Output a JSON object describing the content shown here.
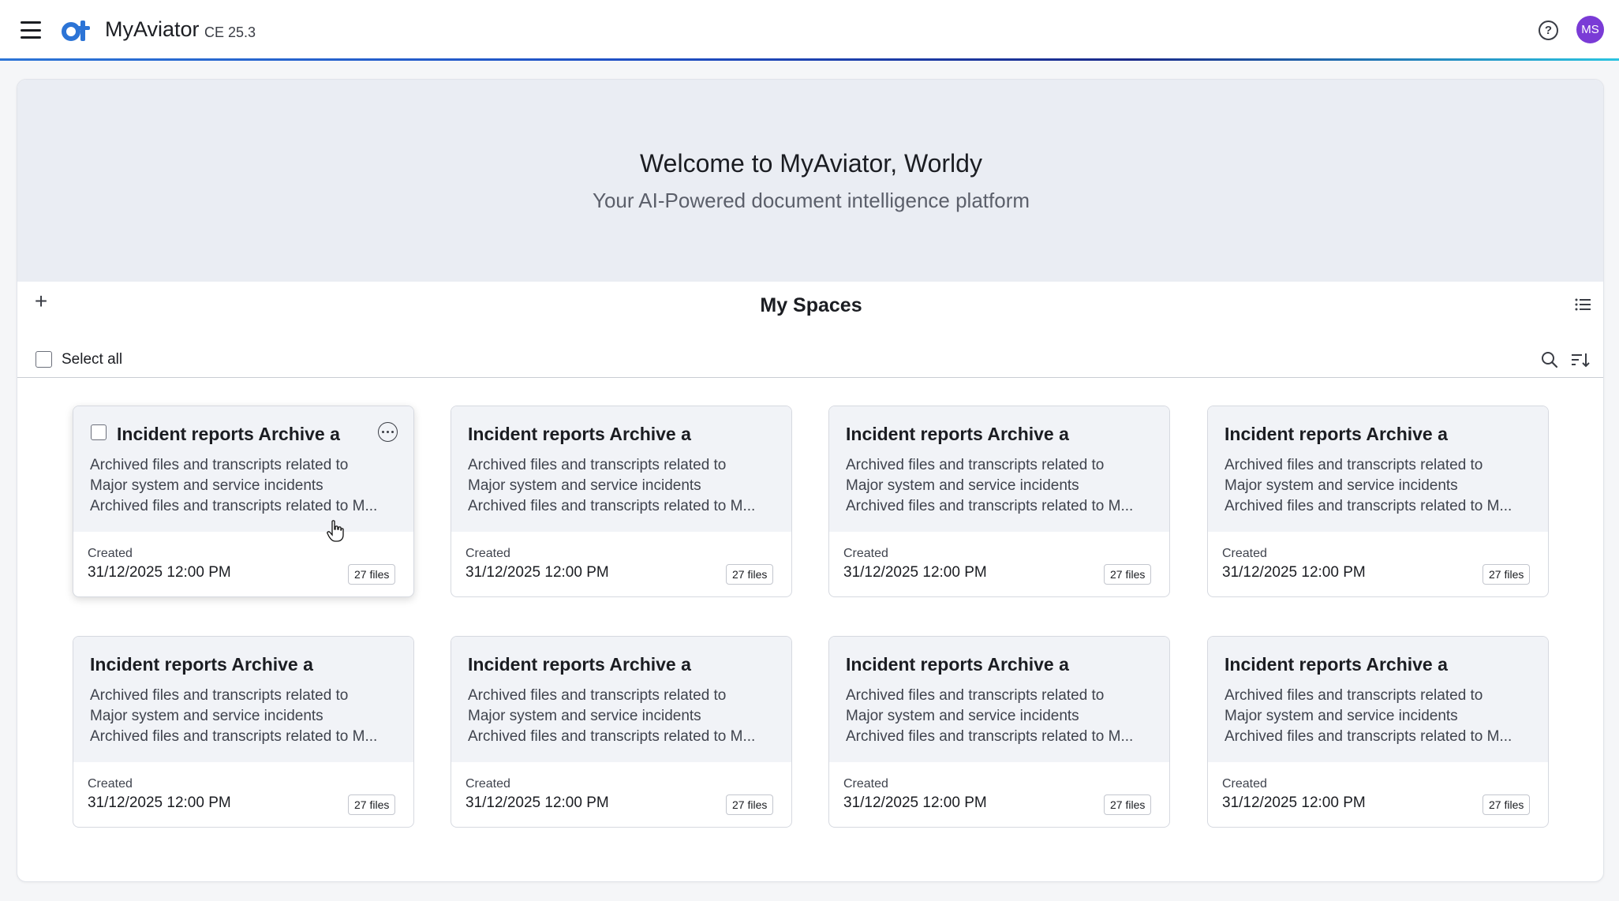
{
  "header": {
    "app_name": "MyAviator",
    "version": "CE 25.3",
    "logo_icon": "ot-logo-icon",
    "help_icon": "help-icon",
    "avatar_initials": "MS",
    "accent_color": "#2c74d6",
    "avatar_color": "#7a3bd6"
  },
  "hero": {
    "title": "Welcome to MyAviator, Worldy",
    "subtitle": "Your AI-Powered document intelligence platform"
  },
  "spaces": {
    "title": "My Spaces",
    "add_icon": "plus-icon",
    "list_view_icon": "list-view-icon",
    "select_all_label": "Select all",
    "search_icon": "search-icon",
    "sort_icon": "sort-icon",
    "cards": [
      {
        "title": "Incident reports Archive a",
        "desc1": "Archived files and transcripts related to",
        "desc2": "Major system and service incidents",
        "desc3": "Archived files and transcripts related to M...",
        "created_label": "Created",
        "created": "31/12/2025  12:00 PM",
        "files": "27 files"
      },
      {
        "title": "Incident reports Archive a",
        "desc1": "Archived files and transcripts related to",
        "desc2": "Major system and service incidents",
        "desc3": "Archived files and transcripts related to M...",
        "created_label": "Created",
        "created": "31/12/2025  12:00 PM",
        "files": "27 files"
      },
      {
        "title": "Incident reports Archive a",
        "desc1": "Archived files and transcripts related to",
        "desc2": "Major system and service incidents",
        "desc3": "Archived files and transcripts related to M...",
        "created_label": "Created",
        "created": "31/12/2025  12:00 PM",
        "files": "27 files"
      },
      {
        "title": "Incident reports Archive a",
        "desc1": "Archived files and transcripts related to",
        "desc2": "Major system and service incidents",
        "desc3": "Archived files and transcripts related to M...",
        "created_label": "Created",
        "created": "31/12/2025  12:00 PM",
        "files": "27 files"
      },
      {
        "title": "Incident reports Archive a",
        "desc1": "Archived files and transcripts related to",
        "desc2": "Major system and service incidents",
        "desc3": "Archived files and transcripts related to M...",
        "created_label": "Created",
        "created": "31/12/2025  12:00 PM",
        "files": "27 files"
      },
      {
        "title": "Incident reports Archive a",
        "desc1": "Archived files and transcripts related to",
        "desc2": "Major system and service incidents",
        "desc3": "Archived files and transcripts related to M...",
        "created_label": "Created",
        "created": "31/12/2025  12:00 PM",
        "files": "27 files"
      },
      {
        "title": "Incident reports Archive a",
        "desc1": "Archived files and transcripts related to",
        "desc2": "Major system and service incidents",
        "desc3": "Archived files and transcripts related to M...",
        "created_label": "Created",
        "created": "31/12/2025  12:00 PM",
        "files": "27 files"
      },
      {
        "title": "Incident reports Archive a",
        "desc1": "Archived files and transcripts related to",
        "desc2": "Major system and service incidents",
        "desc3": "Archived files and transcripts related to M...",
        "created_label": "Created",
        "created": "31/12/2025  12:00 PM",
        "files": "27 files"
      }
    ]
  }
}
